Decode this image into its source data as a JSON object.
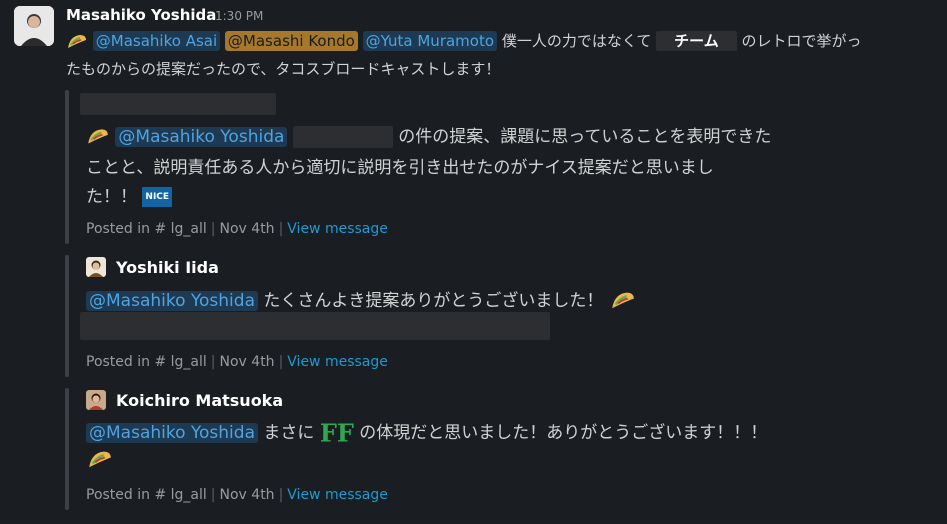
{
  "message": {
    "author": "Masahiko Yoshida",
    "time": "1:30 PM",
    "mention_1": "@Masahiko Asai",
    "mention_2": "@Masashi Kondo",
    "mention_3": "@Yuta Muramoto",
    "text_a": "僕一人の力ではなくて",
    "team_chip": "チーム",
    "text_b": "のレトロで挙がっ",
    "text_c": "たものからの提案だったので、タコスブロードキャストします！"
  },
  "quotes": [
    {
      "mention": "@Masahiko Yoshida",
      "line1": "の件の提案、課題に思っていることを表明できた",
      "line2": "ことと、説明責任ある人から適切に説明を引き出せたのがナイス提案だと思いまし",
      "line3": "た！！",
      "nice_label": "NICE",
      "posted_in": "Posted in",
      "channel": "# lg_all",
      "date": "Nov 4th",
      "view": "View message"
    },
    {
      "author": "Yoshiki Iida",
      "mention": "@Masahiko Yoshida",
      "line1": "たくさんよき提案ありがとうございました！",
      "posted_in": "Posted in",
      "channel": "# lg_all",
      "date": "Nov 4th",
      "view": "View message"
    },
    {
      "author": "Koichiro Matsuoka",
      "mention": "@Masahiko Yoshida",
      "line1a": "まさに",
      "ff_label": "FF",
      "line1b": "の体現だと思いました！ありがとうございます！！！",
      "posted_in": "Posted in",
      "channel": "# lg_all",
      "date": "Nov 4th",
      "view": "View message"
    }
  ],
  "colors": {
    "background": "#1a1d21",
    "mention_bg": "#1d3a52",
    "mention_text": "#4fa3e0",
    "highlight_mention": "#a8782a",
    "link": "#1d9bd1",
    "ff_green": "#2fa84f"
  }
}
